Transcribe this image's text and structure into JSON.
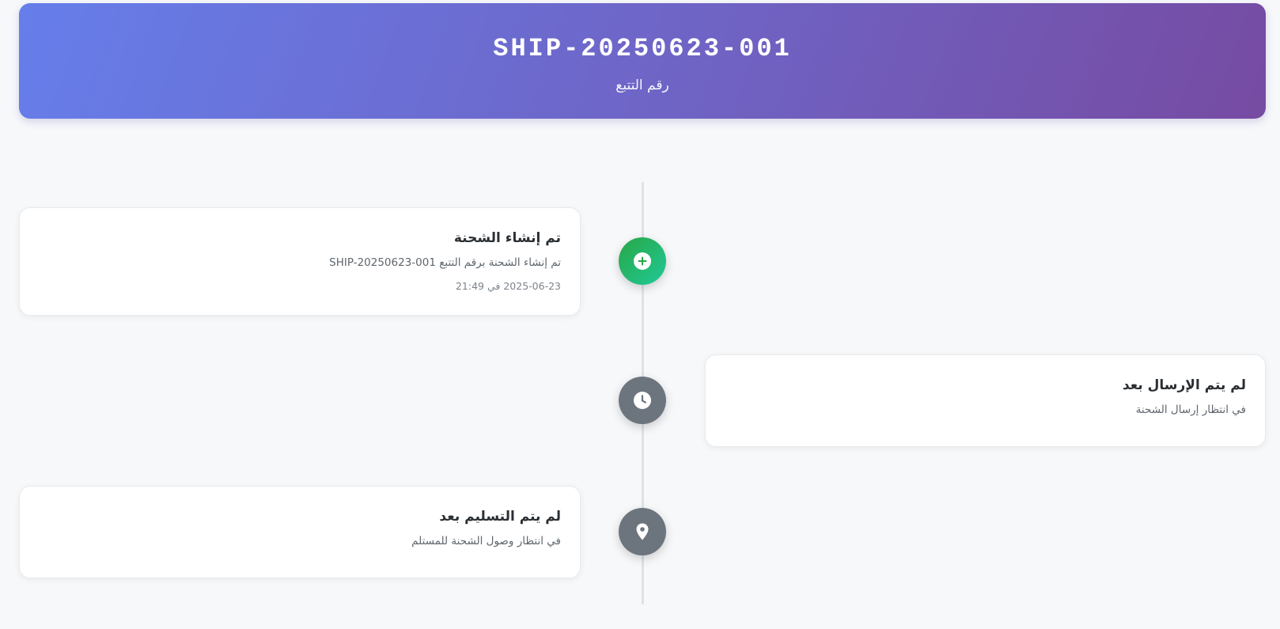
{
  "header": {
    "tracking_number": "SHIP-20250623-001",
    "tracking_label": "رقم التتبع"
  },
  "colors": {
    "header_gradient_start": "#667eea",
    "header_gradient_end": "#764ba2",
    "marker_done": "#28a745",
    "marker_pending": "#6c757d",
    "page_background": "#f7f8fa"
  },
  "timeline": {
    "events": [
      {
        "title": "تم إنشاء الشحنة",
        "description": "تم إنشاء الشحنة برقم التتبع SHIP-20250623-001",
        "timestamp": "2025-06-23 في 21:49",
        "status": "completed",
        "icon": "plus-icon"
      },
      {
        "title": "لم يتم الإرسال بعد",
        "description": "في انتظار إرسال الشحنة",
        "status": "pending",
        "icon": "clock-icon"
      },
      {
        "title": "لم يتم التسليم بعد",
        "description": "في انتظار وصول الشحنة للمستلم",
        "status": "pending",
        "icon": "map-pin-icon"
      }
    ]
  }
}
